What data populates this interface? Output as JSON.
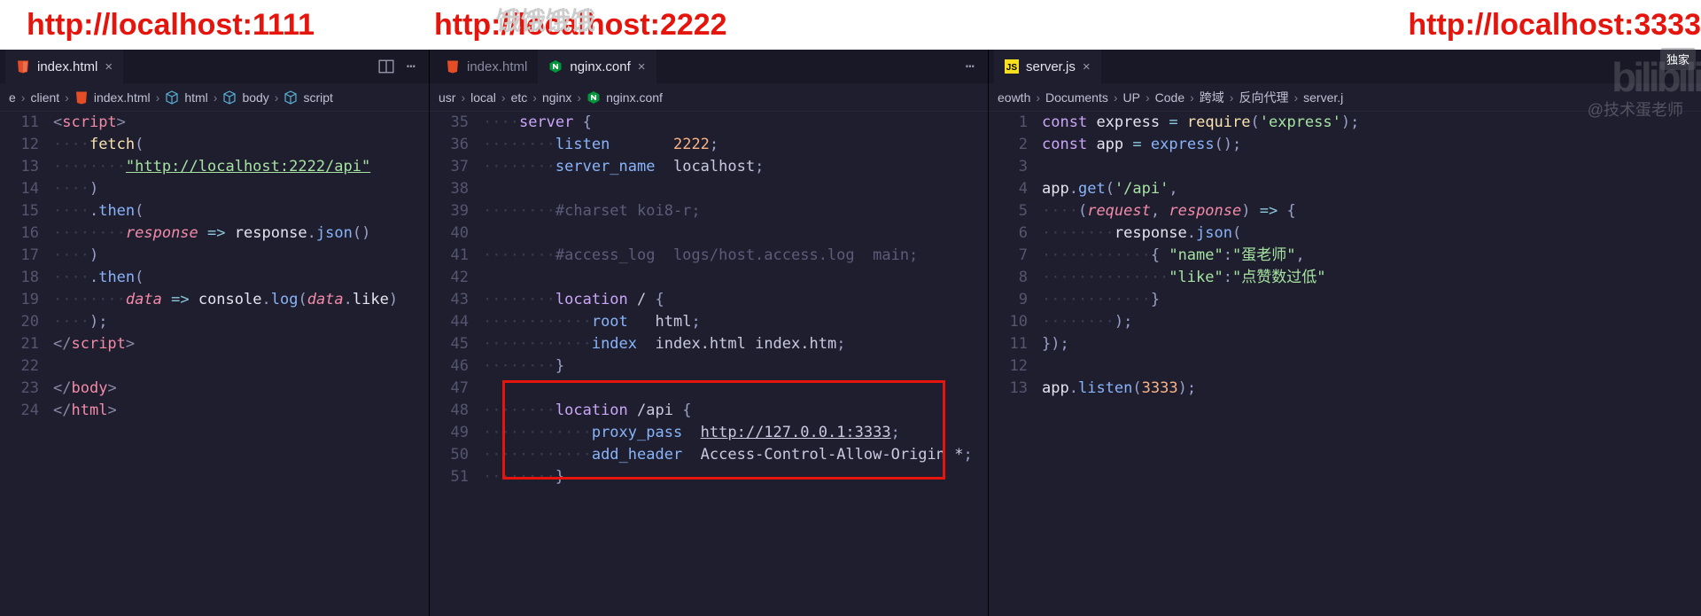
{
  "watermark_top": "饿饿饿饿",
  "logo_text": "bilibili",
  "badge_text": "独家",
  "author_text": "@技术蛋老师",
  "headers": {
    "left": "http://localhost:1111",
    "center": "http://localhost:2222",
    "right": "http://localhost:3333"
  },
  "pane1": {
    "tab": "index.html",
    "breadcrumb": [
      "e",
      "client",
      "index.html",
      "html",
      "body",
      "script"
    ],
    "lines": [
      {
        "n": 11,
        "html": "<span class='tag-br'>&lt;</span><span class='tag-nm'>script</span><span class='tag-br'>&gt;</span>"
      },
      {
        "n": 12,
        "html": "<span class='ws'>····</span><span class='fn-y'>fetch</span><span class='punct'>(</span>"
      },
      {
        "n": 13,
        "html": "<span class='ws'>········</span><span class='str underline'>\"http://localhost:2222/api\"</span>"
      },
      {
        "n": 14,
        "html": "<span class='ws'>····</span><span class='punct'>)</span>"
      },
      {
        "n": 15,
        "html": "<span class='ws'>····</span><span class='punct'>.</span><span class='fn'>then</span><span class='punct'>(</span>"
      },
      {
        "n": 16,
        "html": "<span class='ws'>········</span><span class='param'>response</span> <span class='op'>=&gt;</span> <span class='var'>response</span><span class='punct'>.</span><span class='fn'>json</span><span class='punct'>()</span>"
      },
      {
        "n": 17,
        "html": "<span class='ws'>····</span><span class='punct'>)</span>"
      },
      {
        "n": 18,
        "html": "<span class='ws'>····</span><span class='punct'>.</span><span class='fn'>then</span><span class='punct'>(</span>"
      },
      {
        "n": 19,
        "html": "<span class='ws'>········</span><span class='param'>data</span> <span class='op'>=&gt;</span> <span class='var'>console</span><span class='punct'>.</span><span class='fn'>log</span><span class='punct'>(</span><span class='param'>data</span><span class='punct'>.</span><span class='var'>like</span><span class='punct'>)</span>"
      },
      {
        "n": 20,
        "html": "<span class='ws'>····</span><span class='punct'>);</span>"
      },
      {
        "n": 21,
        "html": "<span class='tag-br'>&lt;/</span><span class='tag-nm'>script</span><span class='tag-br'>&gt;</span>"
      },
      {
        "n": 22,
        "html": ""
      },
      {
        "n": 23,
        "html": "<span class='tag-br'>&lt;/</span><span class='tag-nm'>body</span><span class='tag-br'>&gt;</span>"
      },
      {
        "n": 24,
        "html": "<span class='tag-br'>&lt;/</span><span class='tag-nm'>html</span><span class='tag-br'>&gt;</span>"
      }
    ]
  },
  "pane2": {
    "tab_inactive": "index.html",
    "tab_active": "nginx.conf",
    "breadcrumb": [
      "usr",
      "local",
      "etc",
      "nginx",
      "nginx.conf"
    ],
    "lines": [
      {
        "n": 35,
        "html": "<span class='ws'>····</span><span class='nx-kw'>server</span> <span class='punct'>{</span>"
      },
      {
        "n": 36,
        "html": "<span class='ws'>········</span><span class='nx-dir'>listen</span>       <span class='nx-num'>2222</span><span class='punct'>;</span>"
      },
      {
        "n": 37,
        "html": "<span class='ws'>········</span><span class='nx-dir'>server_name</span>  <span class='nx-str'>localhost</span><span class='punct'>;</span>"
      },
      {
        "n": 38,
        "html": ""
      },
      {
        "n": 39,
        "html": "<span class='ws'>········</span><span class='comment'>#charset koi8-r;</span>"
      },
      {
        "n": 40,
        "html": ""
      },
      {
        "n": 41,
        "html": "<span class='ws'>········</span><span class='comment'>#access_log  logs/host.access.log  main;</span>"
      },
      {
        "n": 42,
        "html": ""
      },
      {
        "n": 43,
        "html": "<span class='ws'>········</span><span class='nx-kw'>location</span> <span class='nx-str'>/</span> <span class='punct'>{</span>"
      },
      {
        "n": 44,
        "html": "<span class='ws'>············</span><span class='nx-dir'>root</span>   <span class='nx-str'>html</span><span class='punct'>;</span>"
      },
      {
        "n": 45,
        "html": "<span class='ws'>············</span><span class='nx-dir'>index</span>  <span class='nx-str'>index.html index.htm</span><span class='punct'>;</span>"
      },
      {
        "n": 46,
        "html": "<span class='ws'>········</span><span class='punct'>}</span>"
      },
      {
        "n": 47,
        "html": ""
      },
      {
        "n": 48,
        "html": "<span class='ws'>········</span><span class='nx-kw'>location</span> <span class='nx-str'>/api</span> <span class='punct'>{</span>"
      },
      {
        "n": 49,
        "html": "<span class='ws'>············</span><span class='nx-dir'>proxy_pass</span>  <span class='nx-str underline'>http://127.0.0.1:3333</span><span class='punct'>;</span>"
      },
      {
        "n": 50,
        "html": "<span class='ws'>············</span><span class='nx-dir'>add_header</span>  <span class='nx-str'>Access-Control-Allow-Origin *</span><span class='punct'>;</span>"
      },
      {
        "n": 51,
        "html": "<span class='ws'>········</span><span class='punct'>}</span>"
      }
    ]
  },
  "pane3": {
    "tab": "server.js",
    "breadcrumb": [
      "eowth",
      "Documents",
      "UP",
      "Code",
      "跨域",
      "反向代理",
      "server.j"
    ],
    "lines": [
      {
        "n": 1,
        "html": "<span class='kw'>const</span> <span class='var'>express</span> <span class='op'>=</span> <span class='fn-y'>require</span><span class='punct'>(</span><span class='str'>'express'</span><span class='punct'>);</span>"
      },
      {
        "n": 2,
        "html": "<span class='kw'>const</span> <span class='var'>app</span> <span class='op'>=</span> <span class='fn'>express</span><span class='punct'>();</span>"
      },
      {
        "n": 3,
        "html": ""
      },
      {
        "n": 4,
        "html": "<span class='var'>app</span><span class='punct'>.</span><span class='fn'>get</span><span class='punct'>(</span><span class='str'>'/api'</span><span class='punct'>,</span>"
      },
      {
        "n": 5,
        "html": "<span class='ws'>····</span><span class='punct'>(</span><span class='param'>request</span><span class='punct'>,</span> <span class='param'>response</span><span class='punct'>)</span> <span class='op'>=&gt;</span> <span class='punct'>{</span>"
      },
      {
        "n": 6,
        "html": "<span class='ws'>········</span><span class='var'>response</span><span class='punct'>.</span><span class='fn'>json</span><span class='punct'>(</span>"
      },
      {
        "n": 7,
        "html": "<span class='ws'>············</span><span class='punct'>{</span> <span class='str'>\"name\"</span><span class='punct'>:</span><span class='str'>\"蛋老师\"</span><span class='punct'>,</span>"
      },
      {
        "n": 8,
        "html": "<span class='ws'>··············</span><span class='str'>\"like\"</span><span class='punct'>:</span><span class='str'>\"点赞数过低\"</span>"
      },
      {
        "n": 9,
        "html": "<span class='ws'>············</span><span class='punct'>}</span>"
      },
      {
        "n": 10,
        "html": "<span class='ws'>········</span><span class='punct'>);</span>"
      },
      {
        "n": 11,
        "html": "<span class='punct'>});</span>"
      },
      {
        "n": 12,
        "html": ""
      },
      {
        "n": 13,
        "html": "<span class='var'>app</span><span class='punct'>.</span><span class='fn'>listen</span><span class='punct'>(</span><span class='nx-num'>3333</span><span class='punct'>);</span>"
      }
    ]
  }
}
